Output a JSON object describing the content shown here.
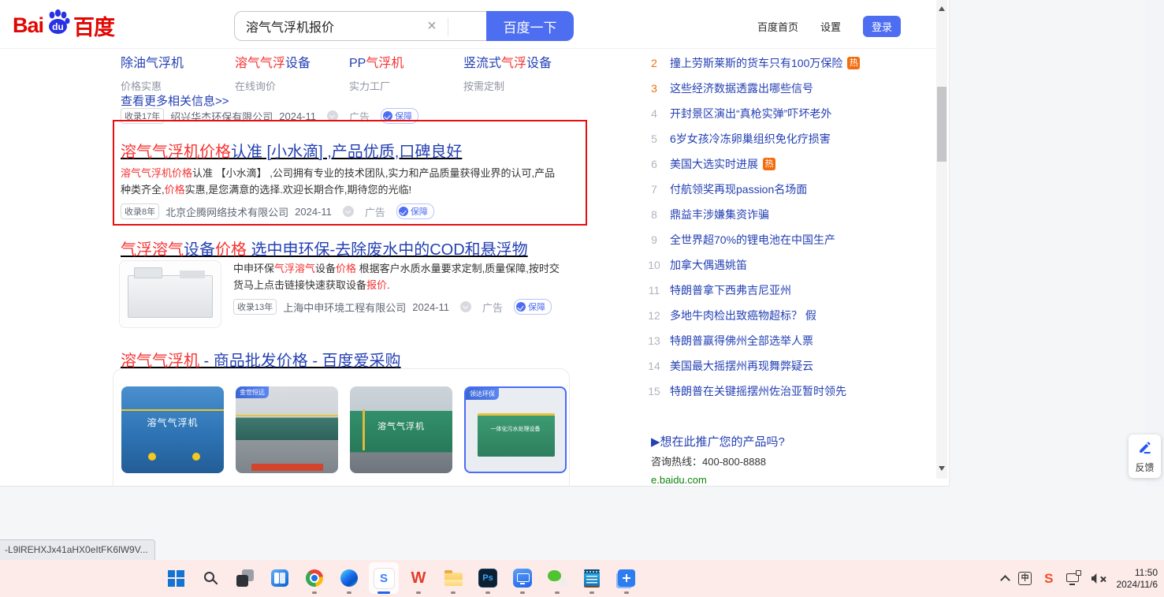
{
  "header": {
    "logo": {
      "bai": "Bai",
      "du": "du",
      "cn": "百度"
    },
    "search": {
      "value": "溶气气浮机报价",
      "clear_icon": "×",
      "button_label": "百度一下"
    },
    "nav": {
      "home": "百度首页",
      "settings": "设置",
      "login": "登录"
    }
  },
  "results": {
    "ad_label": "广告",
    "guarantee_label": "保障",
    "related": {
      "columns": [
        {
          "title_parts": [
            {
              "t": "除油气浮机",
              "c": "blue"
            }
          ],
          "subtitle": "价格实惠"
        },
        {
          "title_parts": [
            {
              "t": "溶气气浮",
              "c": "red"
            },
            {
              "t": "设备",
              "c": "blue"
            }
          ],
          "subtitle": "在线询价"
        },
        {
          "title_parts": [
            {
              "t": "PP",
              "c": "blue"
            },
            {
              "t": "气浮机",
              "c": "red"
            }
          ],
          "subtitle": "实力工厂"
        },
        {
          "title_parts": [
            {
              "t": "竖流式",
              "c": "blue"
            },
            {
              "t": "气浮",
              "c": "red"
            },
            {
              "t": "设备",
              "c": "blue"
            }
          ],
          "subtitle": "按需定制"
        }
      ],
      "more_label": "查看更多相关信息>>",
      "meta": {
        "badge": "收录17年",
        "company": "绍兴华杰环保有限公司",
        "date": "2024-11"
      }
    },
    "r1": {
      "title_parts": [
        {
          "t": "溶气气浮机价格",
          "c": "red"
        },
        {
          "t": "认准 [小水滴] ,产品优质,口碑良好",
          "c": "blue"
        }
      ],
      "desc_parts": [
        {
          "t": "溶气气浮机价格",
          "c": "red"
        },
        {
          "t": "认准 【小水滴】 ,公司拥有专业的技术团队,实力和产品质量获得业界的认可,产品种类齐全,"
        },
        {
          "t": "价格",
          "c": "red"
        },
        {
          "t": "实惠,是您满意的选择.欢迎长期合作,期待您的光临!"
        }
      ],
      "meta": {
        "badge": "收录8年",
        "company": "北京企腾网络技术有限公司",
        "date": "2024-11"
      }
    },
    "r2": {
      "title_parts": [
        {
          "t": "气浮溶气",
          "c": "red"
        },
        {
          "t": "设备",
          "c": "blue"
        },
        {
          "t": "价格",
          "c": "red"
        },
        {
          "t": " 选中申环保-去除废水中的COD和悬浮物",
          "c": "blue"
        }
      ],
      "desc_parts": [
        {
          "t": "中申环保"
        },
        {
          "t": "气浮溶气",
          "c": "red"
        },
        {
          "t": "设备"
        },
        {
          "t": "价格",
          "c": "red"
        },
        {
          "t": " 根据客户水质水量要求定制,质量保障,按时交货马上点击链接快速获取设备"
        },
        {
          "t": "报价",
          "c": "red"
        },
        {
          "t": "."
        }
      ],
      "meta": {
        "badge": "收录13年",
        "company": "上海中申环境工程有限公司",
        "date": "2024-11"
      }
    },
    "r3": {
      "title_parts": [
        {
          "t": "溶气气浮机",
          "c": "red"
        },
        {
          "t": " - 商品批发价格 - 百度爱采购",
          "c": "blue"
        }
      ],
      "images": [
        {
          "label": "溶气气浮机"
        },
        {
          "badge": "金世恒远"
        },
        {
          "label": "溶气气浮机"
        },
        {
          "badge": "领达环保",
          "label": "一体化污水处理设备"
        }
      ]
    }
  },
  "hotlist": {
    "hot_badge_label": "热",
    "items": [
      {
        "rank": "2",
        "text": "撞上劳斯莱斯的货车只有100万保险",
        "hot": true,
        "rank_class": "hot"
      },
      {
        "rank": "3",
        "text": "这些经济数据透露出哪些信号",
        "rank_class": "hot"
      },
      {
        "rank": "4",
        "text": "开封景区演出“真枪实弹”吓坏老外"
      },
      {
        "rank": "5",
        "text": "6岁女孩冷冻卵巢组织免化疗损害"
      },
      {
        "rank": "6",
        "text": "美国大选实时进展",
        "hot": true
      },
      {
        "rank": "7",
        "text": "付航领奖再现passion名场面"
      },
      {
        "rank": "8",
        "text": "鼎益丰涉嫌集资诈骗"
      },
      {
        "rank": "9",
        "text": "全世界超70%的锂电池在中国生产"
      },
      {
        "rank": "10",
        "text": "加拿大偶遇姚笛"
      },
      {
        "rank": "11",
        "text": "特朗普拿下西弗吉尼亚州"
      },
      {
        "rank": "12",
        "text": "多地牛肉检出致癌物超标？ 假"
      },
      {
        "rank": "13",
        "text": "特朗普赢得佛州全部选举人票"
      },
      {
        "rank": "14",
        "text": "美国最大摇摆州再现舞弊疑云"
      },
      {
        "rank": "15",
        "text": "特朗普在关键摇摆州佐治亚暂时领先"
      }
    ],
    "promo": {
      "title": "▶想在此推广您的产品吗?",
      "hotline": "咨询热线：400-800-8888",
      "url": "e.baidu.com"
    }
  },
  "feedback": {
    "label": "反馈"
  },
  "statusbar": {
    "text": "-L9lREHXJx41aHX0eItFK6lW9V..."
  },
  "taskbar": {
    "glyphs": {
      "sogou": "S",
      "wps": "W",
      "ps": "Ps"
    },
    "tray": {
      "ime": "中",
      "sogou": "S",
      "time": "11:50",
      "date": "2024/11/6"
    }
  }
}
